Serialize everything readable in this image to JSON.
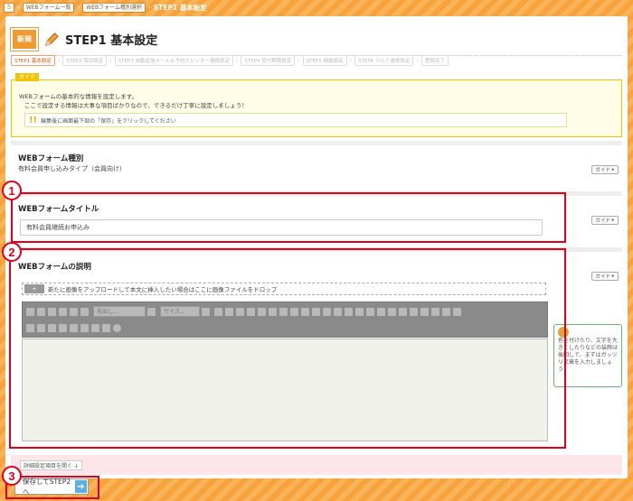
{
  "breadcrumb": {
    "home": "5",
    "items": [
      "WEBフォーム一覧",
      "WEBフォーム種別選択"
    ],
    "current": "STEP1 基本設定"
  },
  "header": {
    "badge": "新規",
    "title": "STEP1 基本設定"
  },
  "steps": [
    "STEP1 基本設定",
    "STEP2 項目設定",
    "STEP3 自動返信メール＆予約カレンダー連携設定",
    "STEP4 受付期限設定",
    "STEP5 機能設定",
    "STEP6 カルテ連携設定",
    "登録完了"
  ],
  "guide": {
    "tag": "ガイド",
    "line1": "WEBフォームの基本的な情報を設定します。",
    "line2": "ここで設定する情報は大事な項目ばかりなので、できるだけ丁寧に設定しましょう！",
    "note": "編集後に画面最下部の「保存」をクリックしてください"
  },
  "sections": {
    "type": {
      "title": "WEBフォーム種別",
      "value": "有料会員申し込みタイプ（会員向け）"
    },
    "form_title": {
      "title": "WEBフォームタイトル",
      "value": "有料会員継続お申込み"
    },
    "description": {
      "title": "WEBフォームの説明",
      "drop_icon_label": "+",
      "drop_text": "新たに画像をアップロードして本文に挿入したい場合はここに画像ファイルをドロップ",
      "toolbar_select1": "見出し...",
      "toolbar_select2": "サイズ..."
    }
  },
  "guide_button": "ガイド",
  "tip_text": "色を付けたり、文字を大きくしたりなどの装飾は後回しで、まずはガッツリ文章を入力しましょう！",
  "detail_link": "詳細設定項目を開く",
  "save_button": "保存してSTEP2へ",
  "annotations": [
    "1",
    "2",
    "3"
  ]
}
